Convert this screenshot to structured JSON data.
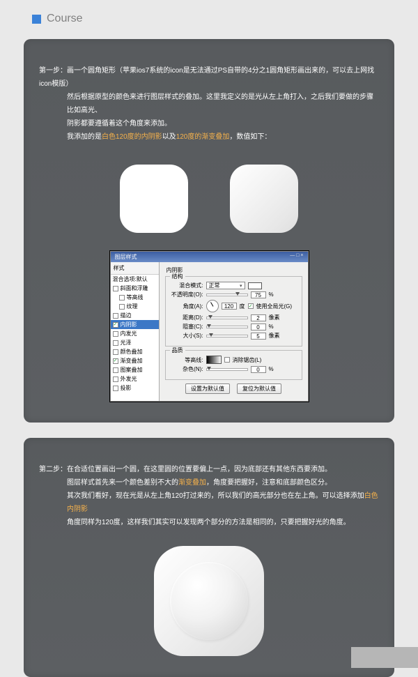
{
  "header": {
    "title": "Course"
  },
  "step1": {
    "label": "第一步：",
    "line1a": "画一个圆角矩形（苹果ios7系统的icon是无法通过PS自带的4分之1圆角矩形画出来的，可以去上网找icon模版）",
    "line2": "然后根据原型的颜色来进行图层样式的叠加。这里我定义的是光从左上角打入，之后我们要做的步骤比如高光、",
    "line3": "阴影都要遵循着这个角度来添加。",
    "line4a": "我添加的是",
    "hl1": "白色120度的内阴影",
    "line4b": "以及",
    "hl2": "120度的渐变叠加",
    "line4c": "，数值如下："
  },
  "dialog": {
    "title": "图层样式",
    "sidebar_head": "样式",
    "blend_defaults": "混合选项:默认",
    "items": [
      {
        "label": "斜面和浮雕",
        "checked": false
      },
      {
        "label": "等高线",
        "checked": false,
        "indent": true
      },
      {
        "label": "纹理",
        "checked": false,
        "indent": true
      },
      {
        "label": "描边",
        "checked": false
      },
      {
        "label": "内阴影",
        "checked": true,
        "selected": true
      },
      {
        "label": "内发光",
        "checked": false
      },
      {
        "label": "光泽",
        "checked": false
      },
      {
        "label": "颜色叠加",
        "checked": false
      },
      {
        "label": "渐变叠加",
        "checked": true
      },
      {
        "label": "图案叠加",
        "checked": false
      },
      {
        "label": "外发光",
        "checked": false
      },
      {
        "label": "投影",
        "checked": false
      }
    ],
    "panel_title": "内阴影",
    "group_struct": "结构",
    "blend_mode_label": "混合模式:",
    "blend_mode_value": "正常",
    "opacity_label": "不透明度(O):",
    "opacity_value": "75",
    "pct": "%",
    "angle_label": "角度(A):",
    "angle_value": "120",
    "angle_unit": "度",
    "global_light": "使用全局光(G)",
    "distance_label": "距离(D):",
    "distance_value": "2",
    "px": "像素",
    "choke_label": "阻塞(C):",
    "choke_value": "0",
    "size_label": "大小(S):",
    "size_value": "5",
    "group_quality": "品质",
    "contour_label": "等高线:",
    "antialias": "消除锯齿(L)",
    "noise_label": "杂色(N):",
    "noise_value": "0",
    "btn_default": "设置为默认值",
    "btn_reset": "复位为默认值"
  },
  "step2": {
    "label": "第二步：",
    "line1": "在合适位置画出一个圆，在这里圆的位置要偏上一点，因为底部还有其他东西要添加。",
    "line2a": "图层样式首先来一个颜色差别不大的",
    "hl1": "渐变叠加",
    "line2b": "，角度要把握好，注意和底部颜色区分。",
    "line3a": "其次我们看好，现在光是从左上角120打过来的，所以我们的高光部分也在左上角。可以选择添加",
    "hl2": "白色内阴影",
    "line4": "角度同样为120度，这样我们其实可以发现两个部分的方法是相同的，只要把握好光的角度。"
  }
}
